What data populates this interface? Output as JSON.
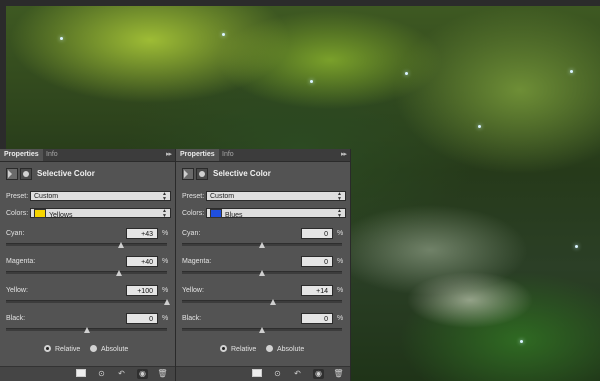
{
  "panels": [
    {
      "tabs": [
        "Properties",
        "Info"
      ],
      "menu_glyph": "▸▸",
      "title": "Selective Color",
      "preset": {
        "label": "Preset:",
        "value": "Custom"
      },
      "colors": {
        "label": "Colors:",
        "value": "Yellows",
        "swatch": "#f7d500"
      },
      "sliders": [
        {
          "label": "Cyan:",
          "value": "+43",
          "unit": "%",
          "level": 0.715
        },
        {
          "label": "Magenta:",
          "value": "+40",
          "unit": "%",
          "level": 0.7
        },
        {
          "label": "Yellow:",
          "value": "+100",
          "unit": "%",
          "level": 1.0
        },
        {
          "label": "Black:",
          "value": "0",
          "unit": "%",
          "level": 0.5
        }
      ],
      "method": {
        "relative": "Relative",
        "absolute": "Absolute",
        "selected": "relative"
      }
    },
    {
      "tabs": [
        "Properties",
        "Info"
      ],
      "menu_glyph": "▸▸",
      "title": "Selective Color",
      "preset": {
        "label": "Preset:",
        "value": "Custom"
      },
      "colors": {
        "label": "Colors:",
        "value": "Blues",
        "swatch": "#1f4fe0"
      },
      "sliders": [
        {
          "label": "Cyan:",
          "value": "0",
          "unit": "%",
          "level": 0.5
        },
        {
          "label": "Magenta:",
          "value": "0",
          "unit": "%",
          "level": 0.5
        },
        {
          "label": "Yellow:",
          "value": "+14",
          "unit": "%",
          "level": 0.57
        },
        {
          "label": "Black:",
          "value": "0",
          "unit": "%",
          "level": 0.5
        }
      ],
      "method": {
        "relative": "Relative",
        "absolute": "Absolute",
        "selected": "relative"
      }
    }
  ],
  "footer_icons": [
    "clip-to-layer-icon",
    "view-previous-state-icon",
    "reset-icon",
    "visibility-icon",
    "delete-icon"
  ]
}
